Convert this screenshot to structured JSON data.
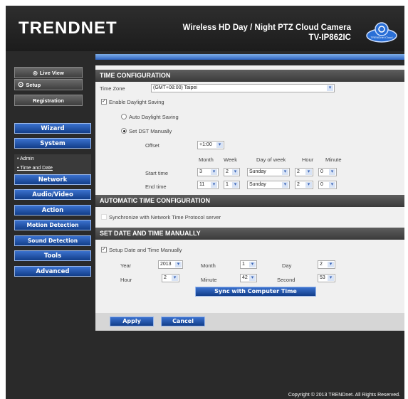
{
  "header": {
    "logo": "TRENDNET",
    "product_line1": "Wireless HD Day / Night PTZ Cloud Camera",
    "product_line2": "TV-IP862IC",
    "cloud_badge": "TRENDnet Cloud"
  },
  "sidebar": {
    "live_view": "Live View",
    "setup": "Setup",
    "registration": "Registration",
    "nav": [
      "Wizard",
      "System",
      "Network",
      "Audio/Video",
      "Action",
      "Motion Detection",
      "Sound Detection",
      "Tools",
      "Advanced"
    ],
    "system_sub": [
      "• Admin",
      "• Time and Date"
    ]
  },
  "time_config": {
    "title": "TIME CONFIGURATION",
    "time_zone_label": "Time Zone",
    "time_zone_value": "(GMT+08:00) Taipei",
    "daylight_label": "Enable Daylight Saving",
    "auto_dst": "Auto Daylight Saving",
    "manual_dst": "Set DST Manually",
    "offset_label": "Offset",
    "offset_value": "+1:00",
    "cols": [
      "Month",
      "Week",
      "Day of week",
      "Hour",
      "Minute"
    ],
    "start_label": "Start time",
    "start": [
      "3",
      "2",
      "Sunday",
      "2",
      "0"
    ],
    "end_label": "End time",
    "end": [
      "11",
      "1",
      "Sunday",
      "2",
      "0"
    ]
  },
  "auto_config": {
    "title": "AUTOMATIC TIME CONFIGURATION",
    "ntp_label": "Synchronize with Network Time Protocol server"
  },
  "manual": {
    "title": "SET DATE AND TIME MANUALLY",
    "setup_label": "Setup Date and Time Manually",
    "year_label": "Year",
    "year": "2013",
    "month_label": "Month",
    "month": "1",
    "day_label": "Day",
    "day": "2",
    "hour_label": "Hour",
    "hour": "2",
    "minute_label": "Minute",
    "minute": "42",
    "second_label": "Second",
    "second": "53",
    "sync_label": "Sync with Computer Time"
  },
  "buttons": {
    "apply": "Apply",
    "cancel": "Cancel"
  },
  "footer": {
    "copyright": "Copyright © 2013 TRENDnet. All Rights Reserved."
  }
}
